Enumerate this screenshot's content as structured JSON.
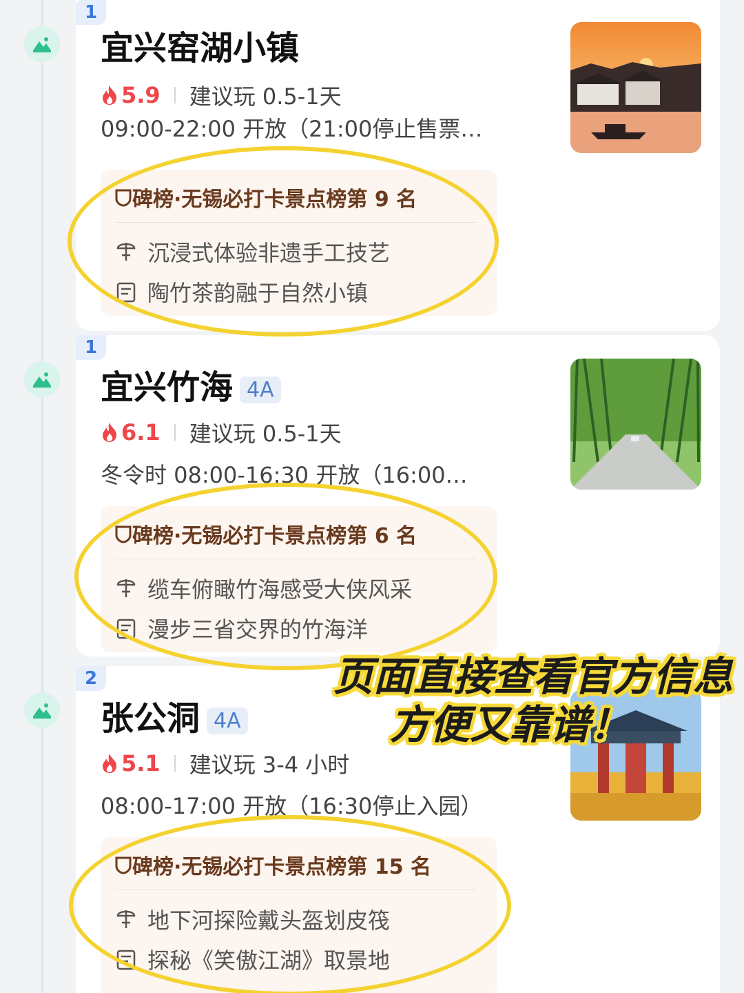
{
  "items": [
    {
      "rank": "1",
      "name": "宜兴窑湖小镇",
      "level": "",
      "heat": "5.9",
      "duration": "建议玩 0.5-1天",
      "hours": "09:00-22:00 开放（21:00停止售票…",
      "list_rank": "碑榜·无锡必打卡景点榜第 9 名",
      "features": [
        "沉浸式体验非遗手工技艺",
        "陶竹茶韵融于自然小镇"
      ]
    },
    {
      "rank": "1",
      "name": "宜兴竹海",
      "level": "4A",
      "heat": "6.1",
      "duration": "建议玩 0.5-1天",
      "hours": "冬令时 08:00-16:30 开放（16:00…",
      "list_rank": "碑榜·无锡必打卡景点榜第 6 名",
      "features": [
        "缆车俯瞰竹海感受大侠风采",
        "漫步三省交界的竹海洋"
      ]
    },
    {
      "rank": "2",
      "name": "张公洞",
      "level": "4A",
      "heat": "5.1",
      "duration": "建议玩 3-4 小时",
      "hours": "08:00-17:00 开放（16:30停止入园）",
      "list_rank": "碑榜·无锡必打卡景点榜第 15 名",
      "features": [
        "地下河探险戴头盔划皮筏",
        "探秘《笑傲江湖》取景地"
      ]
    }
  ],
  "overlay": {
    "line1": "页面直接查看官方信息",
    "line2": "方便又靠谱！"
  },
  "colors": {
    "heat": "#f0464b",
    "rank_tag": "#3c78d8",
    "highlight_ring": "#f4d230",
    "rank_text": "#6a3a1e"
  },
  "icons": {
    "pin": "scenic-mountain-icon",
    "heat": "flame-icon",
    "feature_1": "umbrella-icon",
    "feature_2": "scroll-icon",
    "rank": "shield-icon"
  }
}
